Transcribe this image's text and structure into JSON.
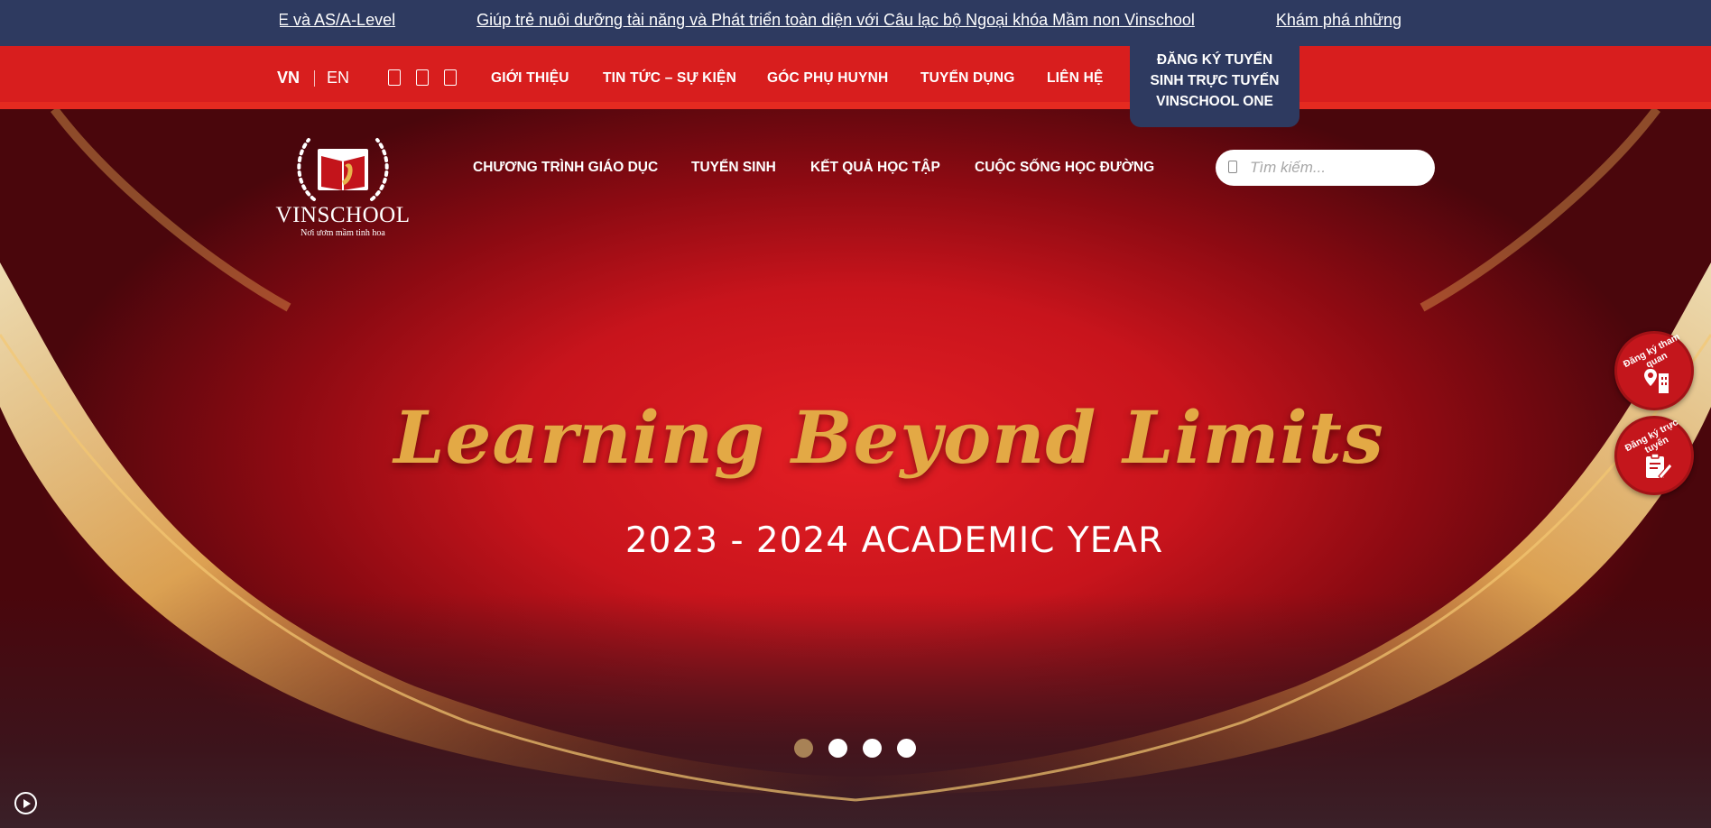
{
  "ticker": {
    "items": [
      "thi IGCSE và AS/A-Level",
      "Giúp trẻ nuôi dưỡng tài năng và Phát triển toàn diện với Câu lạc bộ Ngoại khóa Mầm non Vinschool",
      "Khám phá những"
    ]
  },
  "topbar": {
    "lang_vn": "VN",
    "lang_en": "EN",
    "social_icons": [
      "facebook-icon",
      "youtube-icon",
      "instagram-icon"
    ],
    "nav": [
      "GIỚI THIỆU",
      "TIN TỨC – SỰ KIỆN",
      "GÓC PHỤ HUYNH",
      "TUYỂN DỤNG",
      "LIÊN HỆ"
    ],
    "enroll_button": "ĐĂNG KÝ TUYỂN SINH TRỰC TUYẾN VINSCHOOL ONE"
  },
  "logo": {
    "name": "VINSCHOOL",
    "tagline": "Nơi ươm mầm tinh hoa"
  },
  "main_nav": [
    "CHƯƠNG TRÌNH GIÁO DỤC",
    "TUYỂN SINH",
    "KẾT QUẢ HỌC TẬP",
    "CUỘC SỐNG HỌC ĐƯỜNG"
  ],
  "search": {
    "placeholder": "Tìm kiếm..."
  },
  "hero": {
    "headline": "Learning Beyond Limits",
    "subline": "2023 - 2024 ACADEMIC YEAR",
    "slide_count": 4,
    "active_slide": 1
  },
  "floating": {
    "visit": "Đăng ký tham quan",
    "online": "Đăng ký trực tuyến"
  },
  "colors": {
    "navy": "#2e3a60",
    "red": "#d81e1e",
    "gold": "#e3a945",
    "dot_active": "#a88256"
  }
}
